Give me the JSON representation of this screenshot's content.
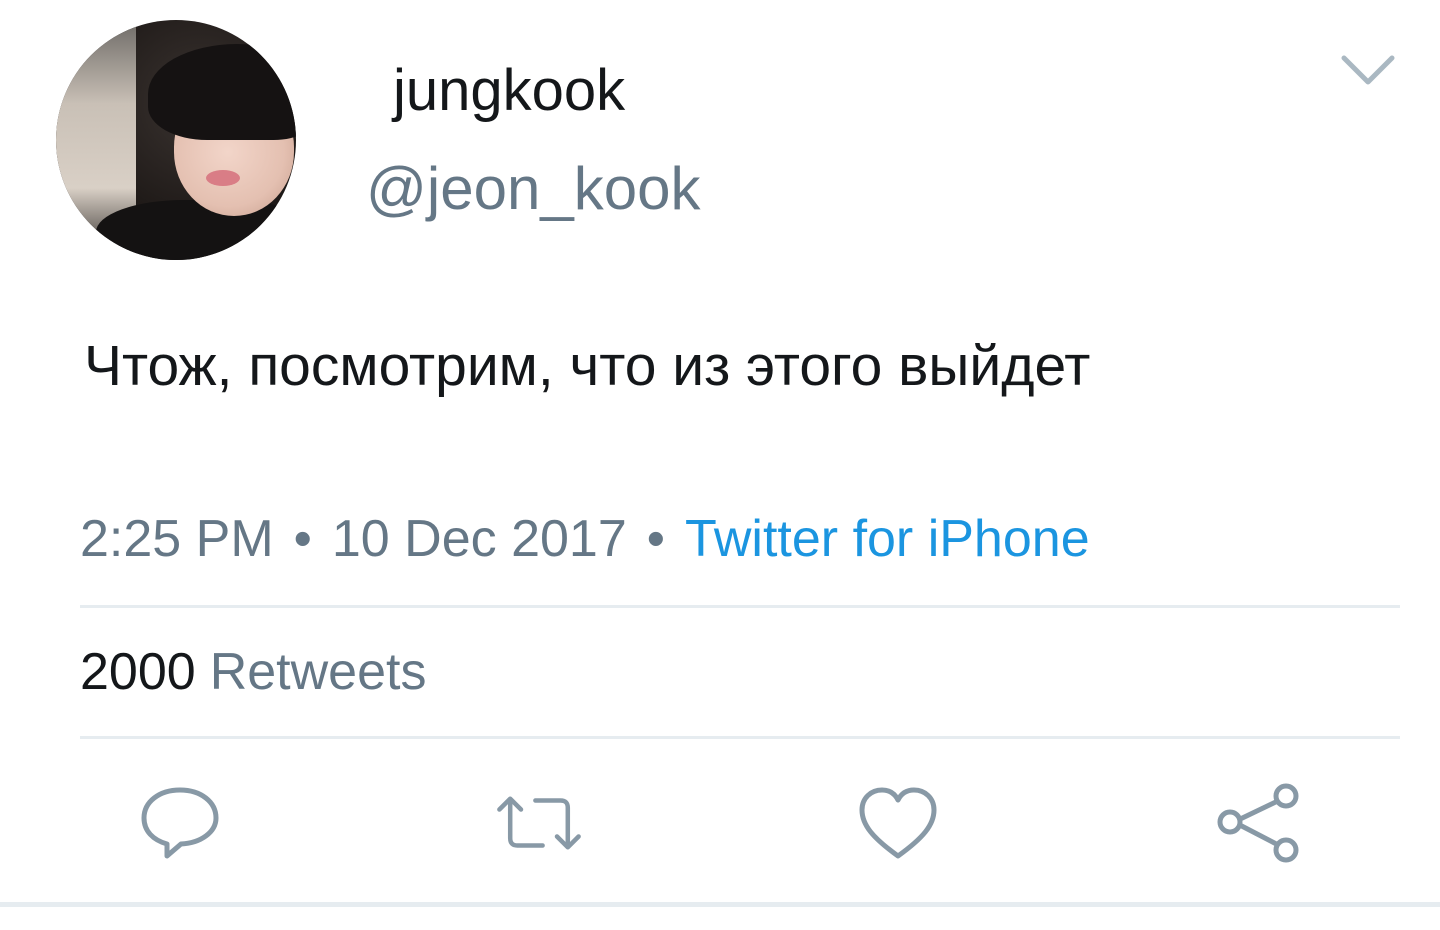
{
  "tweet": {
    "author": {
      "display_name": "jungkook",
      "handle": "@jeon_kook",
      "avatar_icon": "profile-photo"
    },
    "text": "Чтож, посмотрим, что из этого выйдет",
    "time": "2:25 PM",
    "separator": "•",
    "date": "10 Dec 2017",
    "source": "Twitter for iPhone",
    "retweets_count": "2000",
    "retweets_label": "Retweets",
    "actions": [
      "reply-icon",
      "retweet-icon",
      "like-icon",
      "share-icon"
    ],
    "menu_icon": "chevron-down-icon"
  },
  "colors": {
    "primary_text": "#14171a",
    "secondary_text": "#657786",
    "link": "#1b95e0",
    "divider": "#e6ecf0",
    "icon": "#8899a6"
  }
}
